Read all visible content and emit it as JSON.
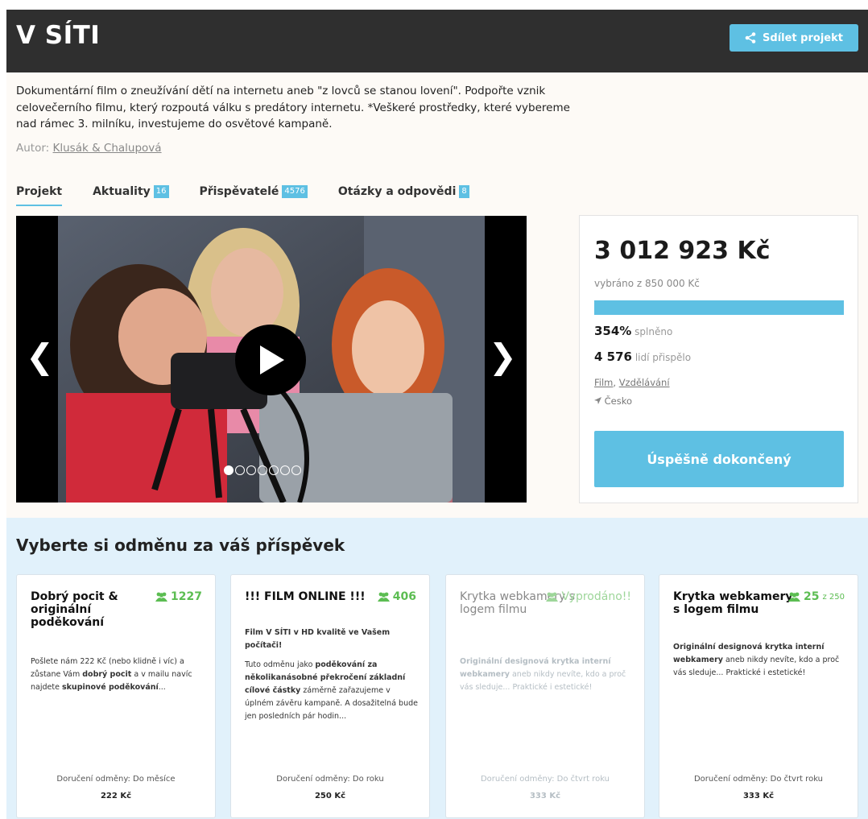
{
  "header": {
    "title": "V SÍTI",
    "share_label": "Sdílet projekt"
  },
  "project": {
    "description": "Dokumentární film o zneužívání dětí na internetu aneb \"z lovců se stanou lovení\". Podpořte vznik celovečerního filmu, který rozpoutá válku s predátory internetu. *Veškeré prostředky, které vybereme nad rámec 3. milníku, investujeme do osvětové kampaně.",
    "author_label": "Autor:",
    "author_name": "Klusák & Chalupová"
  },
  "tabs": [
    {
      "label": "Projekt",
      "badge": null,
      "active": true
    },
    {
      "label": "Aktuality",
      "badge": "16"
    },
    {
      "label": "Přispěvatelé",
      "badge": "4576"
    },
    {
      "label": "Otázky a odpovědi",
      "badge": "8"
    }
  ],
  "gallery": {
    "prev": "❮",
    "next": "❯",
    "slide_count": 7,
    "active_slide": 1
  },
  "stats": {
    "amount": "3 012 923 Kč",
    "goal": "vybráno z 850 000 Kč",
    "progress_fraction": 1.0,
    "percent_value": "354%",
    "percent_label": "splněno",
    "backers_value": "4 576",
    "backers_label": "lidí přispělo",
    "category_1": "Film",
    "category_sep": ", ",
    "category_2": "Vzdělávání",
    "location": "Česko",
    "status_button": "Úspěšně dokončený"
  },
  "colors": {
    "accent": "#5ec0e3",
    "header_bg": "#2f2f2f",
    "count_green": "#5cbd52",
    "rewards_bg": "#e1f1fb"
  },
  "rewards": {
    "title": "Vyberte si odměnu za váš příspěvek",
    "cards": [
      {
        "title": "Dobrý pocit & originální poděkování",
        "count": "1227",
        "count_of": "",
        "desc_parts": [
          {
            "t": "Pošlete nám 222 Kč (nebo klidně i víc) a zůstane Vám ",
            "b": false
          },
          {
            "t": "dobrý pocit",
            "b": true
          },
          {
            "t": " a v mailu navíc najdete ",
            "b": false
          },
          {
            "t": "skupinové poděkování",
            "b": true
          },
          {
            "t": "...",
            "b": false
          }
        ],
        "delivery": "Doručení odměny: Do měsíce",
        "price": "222 Kč",
        "sold_out": false
      },
      {
        "title": "!!! FILM ONLINE !!!",
        "count": "406",
        "count_of": "",
        "desc_parts": [
          {
            "t": "Film V SÍTI v HD kvalitě ve Vašem počítači!",
            "b": true,
            "br": true
          },
          {
            "t": "Tuto odměnu jako ",
            "b": false
          },
          {
            "t": "poděkování za několikanásobné překročení základní cílové částky",
            "b": true
          },
          {
            "t": " záměrně zařazujeme v úplném závěru kampaně. A dosažitelná bude jen posledních pár hodin...",
            "b": false
          }
        ],
        "delivery": "Doručení odměny: Do roku",
        "price": "250 Kč",
        "sold_out": false
      },
      {
        "title": "Krytka webkamery s logem filmu",
        "count": "Vyprodáno!!",
        "count_of": "",
        "desc_parts": [
          {
            "t": "Originální designová krytka interní webkamery",
            "b": true
          },
          {
            "t": " aneb nikdy nevíte, kdo a proč vás sleduje... Praktické i estetické!",
            "b": false
          }
        ],
        "delivery": "Doručení odměny: Do čtvrt roku",
        "price": "333 Kč",
        "sold_out": true
      },
      {
        "title": "Krytka webkamery s logem filmu",
        "count": "25",
        "count_of": "z 250",
        "desc_parts": [
          {
            "t": "Originální designová krytka interní webkamery",
            "b": true
          },
          {
            "t": " aneb nikdy nevíte, kdo a proč vás sleduje... Praktické i estetické!",
            "b": false
          }
        ],
        "delivery": "Doručení odměny: Do čtvrt roku",
        "price": "333 Kč",
        "sold_out": false
      }
    ]
  }
}
